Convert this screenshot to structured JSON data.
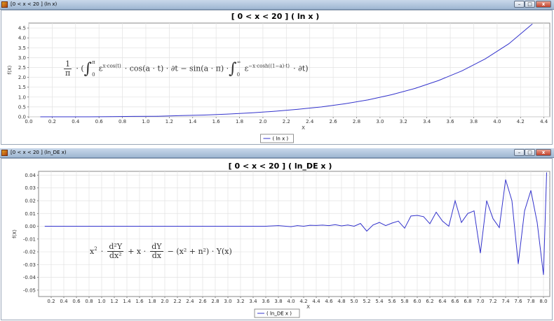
{
  "windows": [
    {
      "title": "[0 < x < 20 ] (ln x)",
      "chart_title": "[ 0 < x < 20 ]  ( ln x )",
      "legend": "( ln x )",
      "formula": {
        "frac_num": "1",
        "frac_den": "π",
        "int1_upper": "π",
        "int1_lower": "0",
        "part1": "ε",
        "part1_exp": "x·cos(t)",
        "part2": "· cos(a · t) · ∂t − sin(a · π) ·",
        "int2_upper": "∞",
        "int2_lower": "0",
        "part3": "ε",
        "part3_exp": "−x·cosh((1−a)·t)",
        "part4": "· ∂t)",
        "lead": "· (",
        "dot": "·"
      }
    },
    {
      "title": "[0 < x < 20 ] (ln_DE x)",
      "chart_title": "[ 0 < x < 20 ]  ( ln_DE x )",
      "legend": "( ln_DE x )",
      "formula": {
        "x2": "x",
        "x2_exp": "2",
        "d2y_num": "d²Y",
        "d2y_den": "dx²",
        "plus_x": "+ x ·",
        "dy_num": "dY",
        "dy_den": "dx",
        "rest": "− (x² + n²) · Y(x)",
        "dot": "·"
      }
    }
  ],
  "window_buttons": {
    "minimize": "–",
    "maximize": "□",
    "close": "x"
  },
  "chart_data": [
    {
      "type": "line",
      "title": "[ 0 < x < 20 ]  ( ln x )",
      "xlabel": "X",
      "ylabel": "f(X)",
      "xlim": [
        0.0,
        4.45
      ],
      "ylim": [
        0.0,
        4.75
      ],
      "xticks": [
        "0.0",
        "0.2",
        "0.4",
        "0.6",
        "0.8",
        "1.0",
        "1.2",
        "1.4",
        "1.6",
        "1.8",
        "2.0",
        "2.2",
        "2.4",
        "2.6",
        "2.8",
        "3.0",
        "3.2",
        "3.4",
        "3.6",
        "3.8",
        "4.0",
        "4.2",
        "4.4"
      ],
      "yticks": [
        "0.0",
        "0.5",
        "1.0",
        "1.5",
        "2.0",
        "2.5",
        "3.0",
        "3.5",
        "4.0",
        "4.5"
      ],
      "grid": true,
      "legend_position": "bottom-center",
      "series": [
        {
          "name": "( ln x )",
          "color": "#3333cc",
          "x": [
            0.1,
            0.3,
            0.5,
            0.7,
            0.9,
            1.1,
            1.3,
            1.5,
            1.7,
            1.9,
            2.1,
            2.3,
            2.5,
            2.7,
            2.9,
            3.1,
            3.3,
            3.5,
            3.7,
            3.9,
            4.1,
            4.3
          ],
          "y": [
            0.0,
            0.0,
            0.0,
            0.01,
            0.02,
            0.03,
            0.06,
            0.09,
            0.14,
            0.2,
            0.28,
            0.38,
            0.5,
            0.66,
            0.86,
            1.12,
            1.44,
            1.84,
            2.33,
            2.94,
            3.7,
            4.7
          ]
        }
      ]
    },
    {
      "type": "line",
      "title": "[ 0 < x < 20 ]  ( ln_DE x )",
      "xlabel": "X",
      "ylabel": "f(X)",
      "xlim": [
        0.0,
        8.1
      ],
      "ylim": [
        -0.055,
        0.043
      ],
      "xticks": [
        "0.2",
        "0.4",
        "0.6",
        "0.8",
        "1.0",
        "1.2",
        "1.4",
        "1.6",
        "1.8",
        "2.0",
        "2.2",
        "2.4",
        "2.6",
        "2.8",
        "3.0",
        "3.2",
        "3.4",
        "3.6",
        "3.8",
        "4.0",
        "4.2",
        "4.4",
        "4.6",
        "4.8",
        "5.0",
        "5.2",
        "5.4",
        "5.6",
        "5.8",
        "6.0",
        "6.2",
        "6.4",
        "6.6",
        "6.8",
        "7.0",
        "7.2",
        "7.4",
        "7.6",
        "7.8",
        "8.0"
      ],
      "yticks": [
        "0.04",
        "0.03",
        "0.02",
        "0.01",
        "0.00",
        "-0.01",
        "-0.02",
        "-0.03",
        "-0.04",
        "-0.05"
      ],
      "grid": true,
      "legend_position": "bottom-center",
      "series": [
        {
          "name": "( ln_DE x )",
          "color": "#3333cc",
          "x": [
            0.1,
            3.6,
            3.8,
            4.0,
            4.1,
            4.2,
            4.3,
            4.4,
            4.5,
            4.6,
            4.7,
            4.8,
            4.9,
            5.0,
            5.1,
            5.2,
            5.3,
            5.4,
            5.5,
            5.6,
            5.7,
            5.8,
            5.9,
            6.0,
            6.1,
            6.2,
            6.3,
            6.4,
            6.5,
            6.6,
            6.7,
            6.8,
            6.9,
            7.0,
            7.1,
            7.2,
            7.3,
            7.4,
            7.5,
            7.6,
            7.7,
            7.8,
            7.9,
            8.0,
            8.05
          ],
          "y": [
            0.0,
            0.0,
            0.0005,
            -0.0003,
            0.0005,
            0.0,
            0.0008,
            0.0006,
            0.0009,
            0.0005,
            0.0012,
            0.0003,
            0.001,
            0.0,
            0.0022,
            -0.0038,
            0.001,
            0.003,
            0.0005,
            0.0025,
            0.004,
            -0.0015,
            0.008,
            0.0085,
            0.0075,
            0.002,
            0.011,
            0.004,
            0.0,
            0.02,
            0.003,
            0.01,
            0.012,
            -0.021,
            0.02,
            0.006,
            -0.001,
            0.0365,
            0.02,
            -0.0295,
            0.012,
            0.028,
            0.003,
            -0.038,
            0.042
          ]
        }
      ]
    }
  ]
}
